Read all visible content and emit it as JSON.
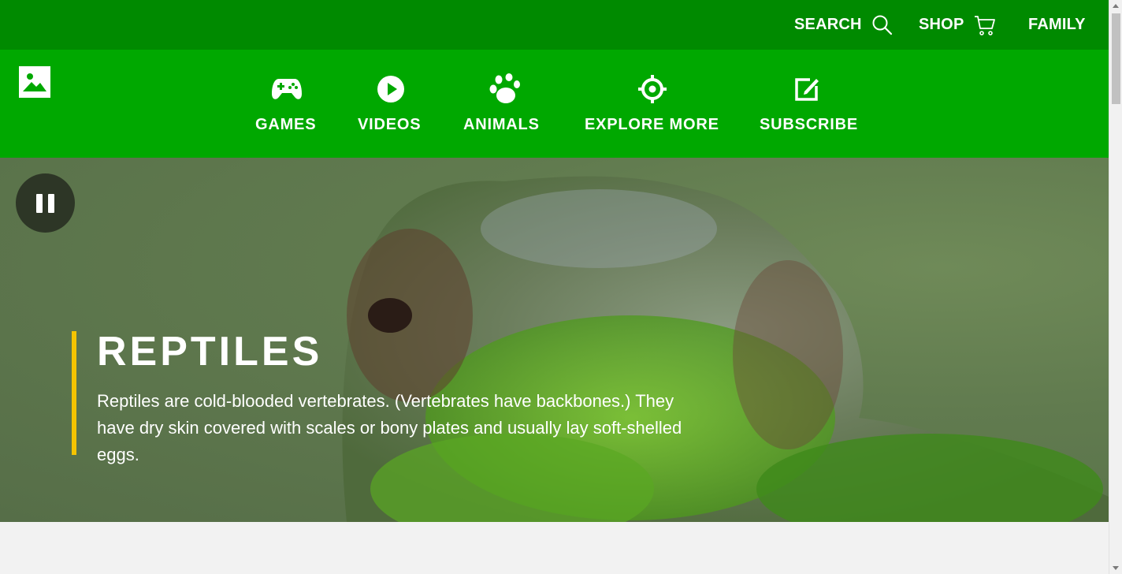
{
  "utility": {
    "search_label": "SEARCH",
    "shop_label": "SHOP",
    "family_label": "FAMILY"
  },
  "nav": {
    "items": [
      {
        "label": "GAMES",
        "icon": "gamepad-icon"
      },
      {
        "label": "VIDEOS",
        "icon": "play-icon"
      },
      {
        "label": "ANIMALS",
        "icon": "paw-icon"
      },
      {
        "label": "EXPLORE MORE",
        "icon": "target-icon"
      },
      {
        "label": "SUBSCRIBE",
        "icon": "edit-icon"
      }
    ]
  },
  "hero": {
    "title": "REPTILES",
    "description": "Reptiles are cold-blooded vertebrates. (Vertebrates have backbones.) They have dry skin covered with scales or bony plates and usually lay soft-shelled eggs."
  },
  "colors": {
    "topbar": "#008a00",
    "navbar": "#00a800",
    "accent": "#f5c400"
  }
}
